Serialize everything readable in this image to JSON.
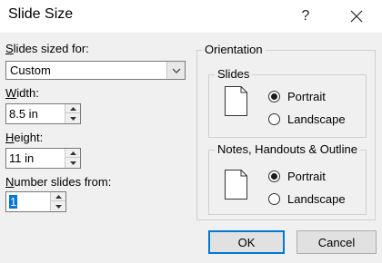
{
  "dialog": {
    "title": "Slide Size",
    "help_label": "?"
  },
  "left": {
    "slides_sized_for_label": "Slides sized for:",
    "slides_sized_for_value": "Custom",
    "width_label": "Width:",
    "width_value": "8.5 in",
    "height_label": "Height:",
    "height_value": "11 in",
    "number_from_label": "Number slides from:",
    "number_from_value": "1"
  },
  "orientation": {
    "caption": "Orientation",
    "slides": {
      "caption": "Slides",
      "portrait_label": "Portrait",
      "landscape_label": "Landscape",
      "selected": "Portrait"
    },
    "notes": {
      "caption": "Notes, Handouts & Outline",
      "portrait_label": "Portrait",
      "landscape_label": "Landscape",
      "selected": "Portrait"
    }
  },
  "buttons": {
    "ok_label": "OK",
    "cancel_label": "Cancel"
  },
  "icons": [
    "close-icon",
    "chevron-down-icon",
    "spin-up-icon",
    "spin-down-icon",
    "portrait-page-icon"
  ],
  "colors": {
    "accent": "#0078d7",
    "background": "#f0f0f0"
  }
}
